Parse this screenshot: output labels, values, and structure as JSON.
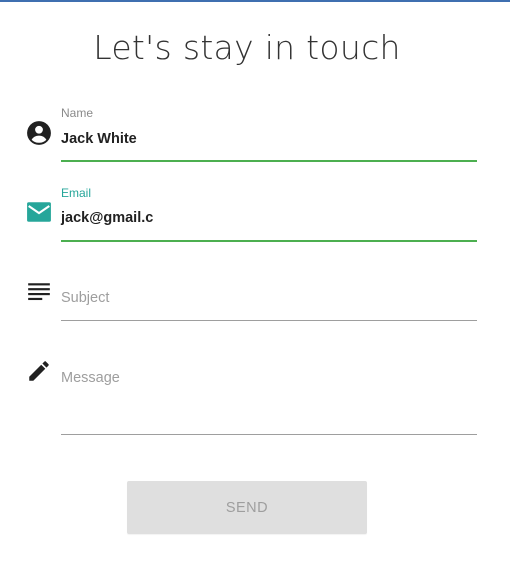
{
  "form": {
    "title": "Let's stay in touch",
    "name": {
      "label": "Name",
      "value": "Jack White",
      "icon": "account-circle-icon"
    },
    "email": {
      "label": "Email",
      "value": "jack@gmail.c",
      "icon": "mail-icon"
    },
    "subject": {
      "placeholder": "Subject",
      "icon": "subject-lines-icon"
    },
    "message": {
      "placeholder": "Message",
      "icon": "pencil-icon"
    },
    "send_label": "SEND"
  },
  "colors": {
    "accent": "#26a69a",
    "valid_underline": "#4caf50",
    "top_bar": "#3f6fb0",
    "disabled_button": "#dfdfdf"
  }
}
